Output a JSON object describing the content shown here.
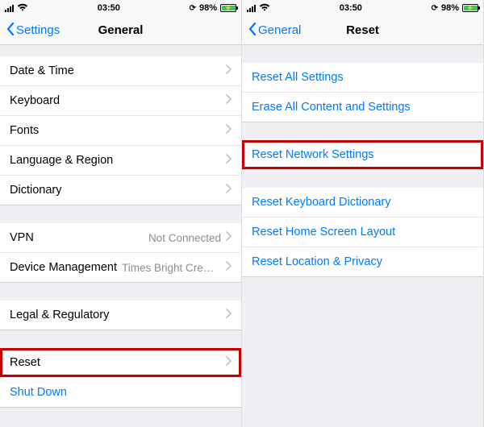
{
  "status": {
    "time": "03:50",
    "battery_pct": "98%"
  },
  "left": {
    "back_label": "Settings",
    "title": "General",
    "rows": {
      "date_time": "Date & Time",
      "keyboard": "Keyboard",
      "fonts": "Fonts",
      "language_region": "Language & Region",
      "dictionary": "Dictionary",
      "vpn": "VPN",
      "vpn_status": "Not Connected",
      "device_mgmt": "Device Management",
      "device_mgmt_detail": "Times Bright CreSu…",
      "legal": "Legal & Regulatory",
      "reset": "Reset",
      "shut_down": "Shut Down"
    }
  },
  "right": {
    "back_label": "General",
    "title": "Reset",
    "rows": {
      "reset_all": "Reset All Settings",
      "erase_all": "Erase All Content and Settings",
      "reset_network": "Reset Network Settings",
      "reset_keyboard": "Reset Keyboard Dictionary",
      "reset_home": "Reset Home Screen Layout",
      "reset_location": "Reset Location & Privacy"
    }
  }
}
